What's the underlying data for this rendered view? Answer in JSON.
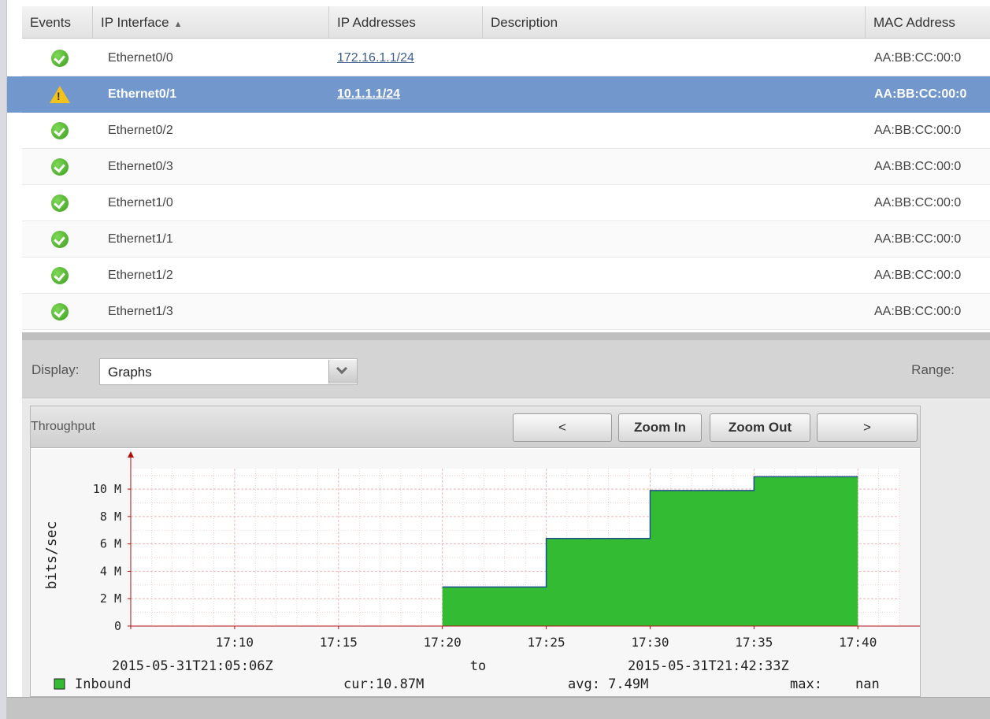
{
  "table": {
    "headers": {
      "events": "Events",
      "ip_interface": "IP Interface",
      "ip_interface_sort": "▲",
      "ip_addresses": "IP Addresses",
      "description": "Description",
      "mac_address": "MAC Address"
    },
    "rows": [
      {
        "status": "ok",
        "interface": "Ethernet0/0",
        "ip": "172.16.1.1/24",
        "description": "",
        "mac": "AA:BB:CC:00:0"
      },
      {
        "status": "warning",
        "interface": "Ethernet0/1",
        "ip": "10.1.1.1/24",
        "description": "",
        "mac": "AA:BB:CC:00:0",
        "selected": true
      },
      {
        "status": "ok",
        "interface": "Ethernet0/2",
        "ip": "",
        "description": "",
        "mac": "AA:BB:CC:00:0"
      },
      {
        "status": "ok",
        "interface": "Ethernet0/3",
        "ip": "",
        "description": "",
        "mac": "AA:BB:CC:00:0"
      },
      {
        "status": "ok",
        "interface": "Ethernet1/0",
        "ip": "",
        "description": "",
        "mac": "AA:BB:CC:00:0"
      },
      {
        "status": "ok",
        "interface": "Ethernet1/1",
        "ip": "",
        "description": "",
        "mac": "AA:BB:CC:00:0"
      },
      {
        "status": "ok",
        "interface": "Ethernet1/2",
        "ip": "",
        "description": "",
        "mac": "AA:BB:CC:00:0"
      },
      {
        "status": "ok",
        "interface": "Ethernet1/3",
        "ip": "",
        "description": "",
        "mac": "AA:BB:CC:00:0"
      }
    ],
    "warning_glyph": "!"
  },
  "display": {
    "label": "Display:",
    "value": "Graphs",
    "range_label": "Range:"
  },
  "panel": {
    "title": "Throughput",
    "prev_label": "<",
    "zoom_in_label": "Zoom In",
    "zoom_out_label": "Zoom Out",
    "next_label": ">"
  },
  "colors": {
    "fill": "#33bb33",
    "line": "#1d4f8c",
    "grid": "#f0b4b4",
    "axis": "#b01010",
    "selected_row": "#7197cc"
  },
  "chart_data": {
    "type": "area",
    "ylabel": "bits/sec",
    "x_ticks": [
      "17:10",
      "17:15",
      "17:20",
      "17:25",
      "17:30",
      "17:35",
      "17:40"
    ],
    "y_ticks": [
      "0",
      "2 M",
      "4 M",
      "6 M",
      "8 M",
      "10 M"
    ],
    "ylim": [
      0,
      11500000
    ],
    "xlim_minutes": [
      "17:05",
      "17:42"
    ],
    "series": [
      {
        "name": "Inbound",
        "x": [
          "17:20",
          "17:25",
          "17:25",
          "17:30",
          "17:30",
          "17:35",
          "17:35",
          "17:40"
        ],
        "values": [
          2850000,
          2850000,
          6400000,
          6400000,
          9900000,
          9900000,
          10900000,
          10900000
        ]
      }
    ],
    "range_start": "2015-05-31T21:05:06Z",
    "range_to": "to",
    "range_end": "2015-05-31T21:42:33Z",
    "legend": {
      "label": "Inbound",
      "cur": "cur:10.87M",
      "avg": "avg: 7.49M",
      "max_label": "max:",
      "max_value": "nan"
    },
    "grid": true
  }
}
